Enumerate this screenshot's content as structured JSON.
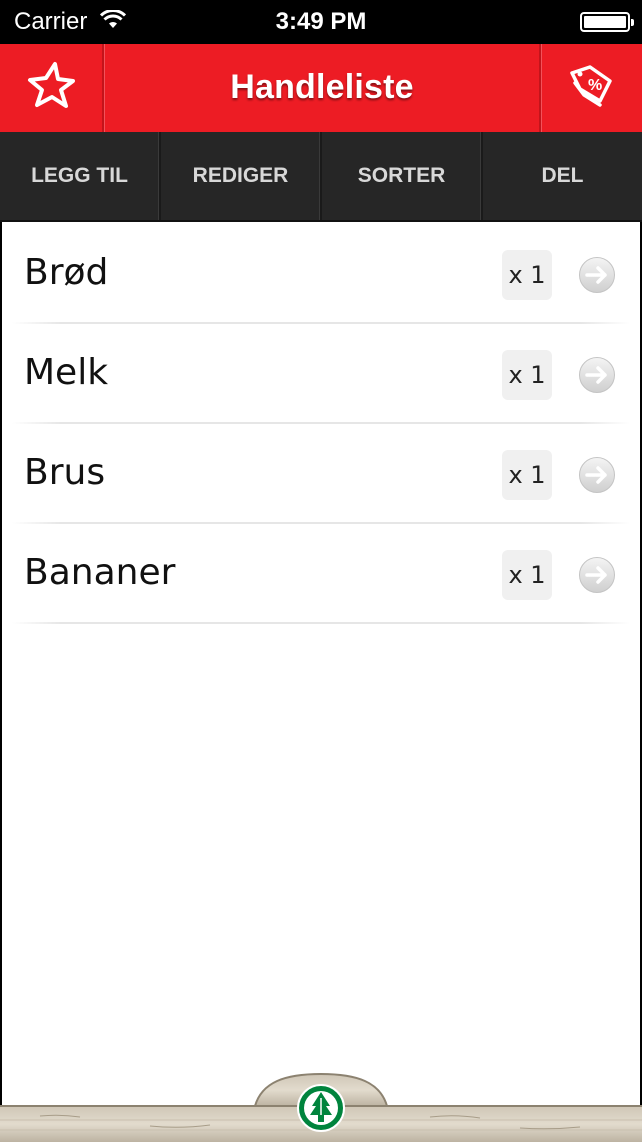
{
  "status_bar": {
    "carrier": "Carrier",
    "time": "3:49 PM"
  },
  "header": {
    "title": "Handleliste",
    "left_icon": "star-icon",
    "right_icon": "price-tag-percent-icon",
    "color": "#ed1c24"
  },
  "toolbar": {
    "add_label": "LEGG TIL",
    "edit_label": "REDIGER",
    "sort_label": "SORTER",
    "share_label": "DEL"
  },
  "items": [
    {
      "name": "Brød",
      "qty": "x 1"
    },
    {
      "name": "Melk",
      "qty": "x 1"
    },
    {
      "name": "Brus",
      "qty": "x 1"
    },
    {
      "name": "Bananer",
      "qty": "x 1"
    }
  ],
  "footer": {
    "logo_icon": "spar-tree-logo",
    "logo_color": "#00843d"
  }
}
